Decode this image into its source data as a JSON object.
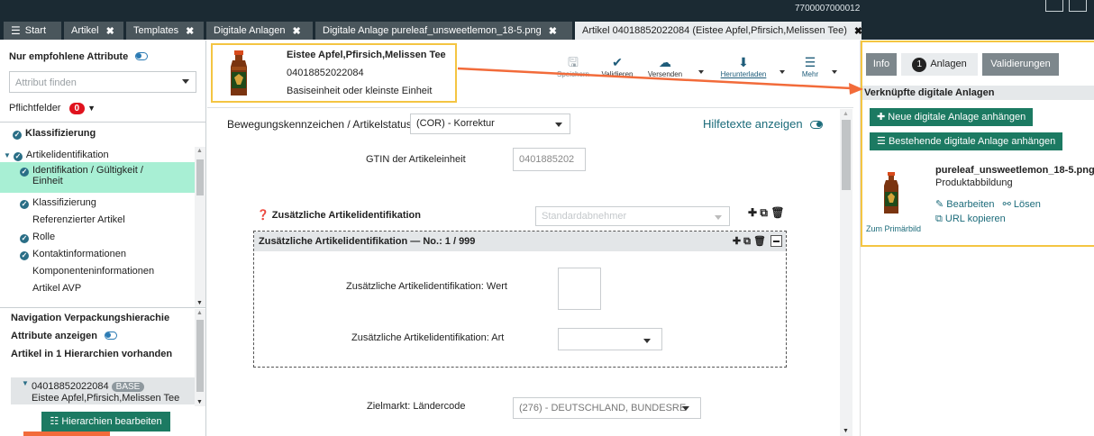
{
  "top": {
    "number": "7700007000012"
  },
  "tabs": [
    {
      "label": "Start",
      "icon": "hamburger-icon"
    },
    {
      "label": "Artikel"
    },
    {
      "label": "Templates"
    },
    {
      "label": "Digitale Anlagen"
    },
    {
      "label": "Digitale Anlage pureleaf_unsweetlemon_18-5.png"
    },
    {
      "label": "Artikel 04018852022084 (Eistee Apfel,Pfirsich,Melissen Tee)"
    }
  ],
  "left": {
    "recommended_label": "Nur empfohlene Attribute",
    "search_placeholder": "Attribut finden",
    "required_label": "Pflichtfelder",
    "required_count": "0",
    "tree": [
      {
        "label": "Klassifizierung",
        "check": true,
        "bold": true,
        "indent": 0
      },
      {
        "label": "Artikelidentifikation",
        "check": true,
        "bold": false,
        "indent": 0,
        "expanded": true
      },
      {
        "label": "Identifikation / Gültigkeit /",
        "label2": "Einheit",
        "check": true,
        "indent": 1,
        "selected": true
      },
      {
        "label": "Klassifizierung",
        "check": true,
        "indent": 1
      },
      {
        "label": "Referenzierter Artikel",
        "check": false,
        "indent": 1
      },
      {
        "label": "Rolle",
        "check": true,
        "indent": 1
      },
      {
        "label": "Kontaktinformationen",
        "check": true,
        "indent": 1
      },
      {
        "label": "Komponenteninformationen",
        "check": false,
        "indent": 1
      },
      {
        "label": "Artikel AVP",
        "check": false,
        "indent": 1
      }
    ],
    "nav_title": "Navigation Verpackungshierachie",
    "show_attrs": "Attribute anzeigen",
    "hier_count": "Artikel in 1 Hierarchien vorhanden",
    "hier_item_gtin": "04018852022084",
    "hier_item_badge": "BASE",
    "hier_item_name": "Eistee Apfel,Pfirsich,Melissen Tee",
    "edit_button": "Hierarchien bearbeiten"
  },
  "product": {
    "name": "Eistee Apfel,Pfirsich,Melissen Tee",
    "gtin": "04018852022084",
    "unit": "Basiseinheit oder kleinste Einheit"
  },
  "toolbar": {
    "save": "Speichern",
    "validate": "Validieren",
    "send": "Versenden",
    "download": "Herunterladen",
    "more": "Mehr"
  },
  "form": {
    "status_label": "Bewegungskennzeichen / Artikelstatus",
    "status_value": "(COR) - Korrektur",
    "help_text": "Hilfetexte anzeigen",
    "gtin_label": "GTIN der Artikeleinheit",
    "gtin_value": "0401885202",
    "addl_id_label": "Zusätzliche Artikelidentifikation",
    "addl_id_placeholder": "Standardabnehmer",
    "section_title": "Zusätzliche Artikelidentifikation — No.: 1 / 999",
    "value_label": "Zusätzliche Artikelidentifikation: Wert",
    "type_label": "Zusätzliche Artikelidentifikation: Art",
    "market_label": "Zielmarkt: Ländercode",
    "market_value": "(276) - DEUTSCHLAND, BUNDESRE"
  },
  "right": {
    "tab_info": "Info",
    "tab_count": "1",
    "tab_attachments": "Anlagen",
    "tab_validations": "Validierungen",
    "header": "Verknüpfte digitale Anlagen",
    "btn_new": "Neue digitale Anlage anhängen",
    "btn_existing": "Bestehende digitale Anlage anhängen",
    "file_name": "pureleaf_unsweetlemon_18-5.png",
    "file_type": "Produktabbildung",
    "edit": "Bearbeiten",
    "detach": "Lösen",
    "primary": "Zum Primärbild",
    "copy_url": "URL kopieren"
  },
  "colors": {
    "accent": "#1c7a62",
    "highlight": "#f4c542",
    "arrow": "#f26b3a",
    "tabbar": "#1b2a33"
  }
}
